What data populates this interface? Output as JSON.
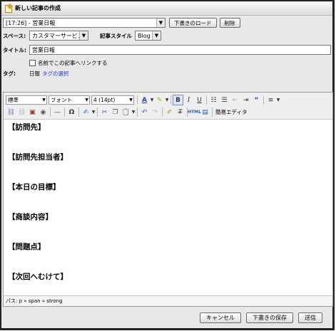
{
  "window": {
    "title": "新しい記事の作成"
  },
  "draft": {
    "selected": "[17:26] - 営業日報",
    "load_button": "下書きのロード",
    "delete_button": "削除"
  },
  "space": {
    "label": "スペース:",
    "value": "カスタマーサービス"
  },
  "article_style": {
    "label": "記事スタイル",
    "value": "Blog"
  },
  "title_field": {
    "label": "タイトル:",
    "value": "営業日報"
  },
  "named_link": {
    "label": "名前でこの記事へリンクする",
    "checked": false
  },
  "tags": {
    "label": "タグ:",
    "value": "日報",
    "select_link": "タグの選択"
  },
  "toolbar": {
    "format": "標準",
    "font": "フォント",
    "size": "4 (14pt)",
    "simple_editor": "簡易エディタ"
  },
  "content": {
    "sections": [
      "【訪問先】",
      "【訪問先担当者】",
      "【本日の目標】",
      "【商談内容】",
      "【問題点】",
      "【次回へむけて】"
    ]
  },
  "status": {
    "path": "パス: p » span » strong"
  },
  "footer": {
    "cancel": "キャンセル",
    "save_draft": "下書きの保存",
    "send": "送信"
  }
}
